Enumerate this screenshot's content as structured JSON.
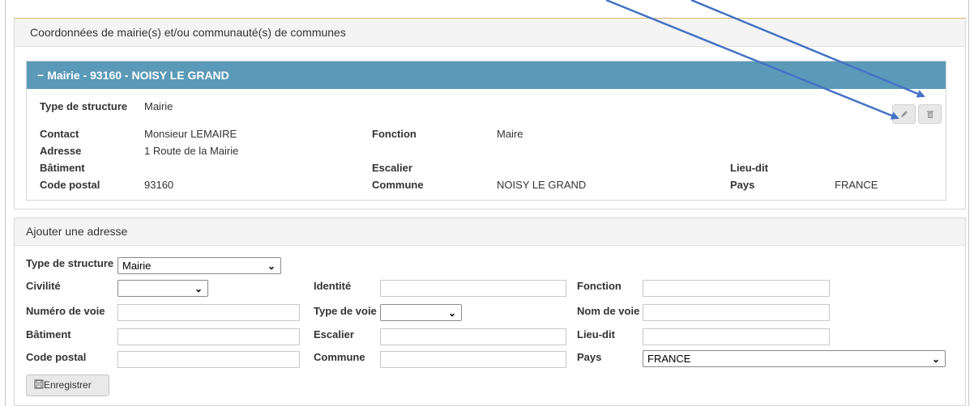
{
  "panel1": {
    "title": "Coordonnées de mairie(s) et/ou communauté(s) de communes",
    "mairie_header": "Mairie - 93160 - NOISY LE GRAND",
    "fields": {
      "type_label": "Type de structure",
      "type_value": "Mairie",
      "contact_label": "Contact",
      "contact_value": "Monsieur LEMAIRE",
      "fonction_label": "Fonction",
      "fonction_value": "Maire",
      "adresse_label": "Adresse",
      "adresse_value": "1 Route de la Mairie",
      "batiment_label": "Bâtiment",
      "escalier_label": "Escalier",
      "lieudit_label": "Lieu-dit",
      "cp_label": "Code postal",
      "cp_value": "93160",
      "commune_label": "Commune",
      "commune_value": "NOISY LE GRAND",
      "pays_label": "Pays",
      "pays_value": "FRANCE"
    },
    "edit_icon": "pencil-icon",
    "delete_icon": "trash-icon"
  },
  "panel2": {
    "title": "Ajouter une adresse",
    "labels": {
      "type": "Type de structure",
      "civilite": "Civilité",
      "identite": "Identité",
      "fonction": "Fonction",
      "numero": "Numéro de voie",
      "type_voie": "Type de voie",
      "nom_voie": "Nom de voie",
      "batiment": "Bâtiment",
      "escalier": "Escalier",
      "lieudit": "Lieu-dit",
      "cp": "Code postal",
      "commune": "Commune",
      "pays": "Pays"
    },
    "values": {
      "type": "Mairie",
      "civilite": "",
      "type_voie": "",
      "pays": "FRANCE"
    },
    "save_label": "Enregistrer",
    "save_icon": "floppy-disk-icon"
  },
  "colors": {
    "header_blue": "#5a9ab8",
    "arrow_blue": "#4472c4"
  }
}
